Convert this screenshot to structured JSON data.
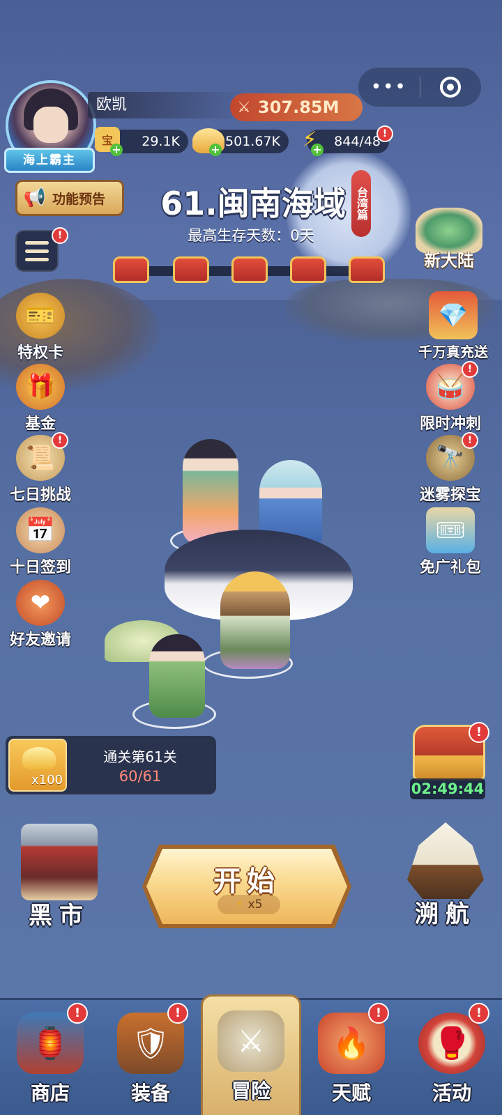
{
  "player": {
    "name": "欧凯",
    "rank": "海上霸主",
    "power": "307.85M"
  },
  "resources": [
    {
      "icon": "treasure-icon",
      "value": "29.1K"
    },
    {
      "icon": "gold-ingot-icon",
      "value": "501.67K"
    },
    {
      "icon": "energy-icon",
      "value": "844/48"
    }
  ],
  "feature_preview": "功能预告",
  "stage": {
    "title": "61.闽南海域",
    "tag": "台湾篇",
    "days": "最高生存天数：0天"
  },
  "left_menu": [
    {
      "label": "特权卡",
      "icon": "privilege-card-icon",
      "badge": false
    },
    {
      "label": "基金",
      "icon": "fund-gift-icon",
      "badge": false
    },
    {
      "label": "七日挑战",
      "icon": "seven-day-challenge-icon",
      "badge": true
    },
    {
      "label": "十日签到",
      "icon": "ten-day-signin-icon",
      "badge": false
    },
    {
      "label": "好友邀请",
      "icon": "friend-invite-icon",
      "badge": false
    }
  ],
  "right_menu": [
    {
      "label": "千万真充送",
      "icon": "recharge-chest-icon",
      "badge": false
    },
    {
      "label": "限时冲刺",
      "icon": "limited-sprint-icon",
      "badge": true
    },
    {
      "label": "迷雾探宝",
      "icon": "fog-treasure-icon",
      "badge": true
    },
    {
      "label": "免广礼包",
      "icon": "ad-free-gift-icon",
      "badge": false
    }
  ],
  "new_continent": "新大陆",
  "reward": {
    "title": "通关第61关",
    "progress": "60/61",
    "item_qty": "x100"
  },
  "timer": "02:49:44",
  "start": {
    "label": "开始",
    "cost": "x5"
  },
  "black_market": "黑市",
  "voyage": "溯航",
  "nav": [
    {
      "label": "商店",
      "icon": "shop-icon",
      "badge": true,
      "active": false
    },
    {
      "label": "装备",
      "icon": "equipment-icon",
      "badge": true,
      "active": false
    },
    {
      "label": "冒险",
      "icon": "adventure-swords-icon",
      "badge": false,
      "active": true
    },
    {
      "label": "天赋",
      "icon": "talent-flame-icon",
      "badge": true,
      "active": false
    },
    {
      "label": "活动",
      "icon": "activity-icon",
      "badge": true,
      "active": false
    }
  ],
  "badge_mark": "!"
}
